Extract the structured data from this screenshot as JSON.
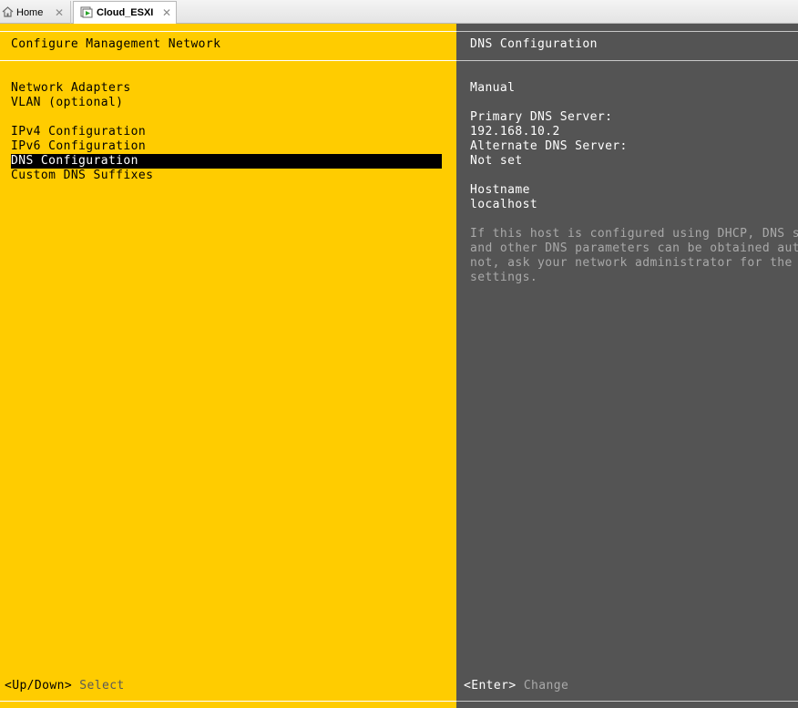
{
  "tabs": {
    "home": {
      "label": "Home",
      "icon": "home-icon"
    },
    "vm": {
      "label": "Cloud_ESXI",
      "icon": "vm-console-icon"
    },
    "close_glyph": "✕"
  },
  "left_panel": {
    "title": "Configure Management Network",
    "menu_items": [
      "Network Adapters",
      "VLAN (optional)",
      "IPv4 Configuration",
      "IPv6 Configuration",
      "DNS Configuration",
      "Custom DNS Suffixes"
    ],
    "selected_index": 4,
    "footer": {
      "key": "<Up/Down>",
      "action": "Select"
    }
  },
  "right_panel": {
    "title": "DNS Configuration",
    "mode": "Manual",
    "primary_dns_label": "Primary DNS Server:",
    "primary_dns_value": "192.168.10.2",
    "alternate_dns_label": "Alternate DNS Server:",
    "alternate_dns_value": "Not set",
    "hostname_label": "Hostname",
    "hostname_value": "localhost",
    "help_lines": [
      "If this host is configured using DHCP, DNS se",
      "and other DNS parameters can be obtained auto",
      "not, ask your network administrator for the a",
      "settings."
    ],
    "footer": {
      "key": "<Enter>",
      "action": "Change"
    }
  },
  "colors": {
    "left_background": "#ffcc00",
    "right_background": "#545454",
    "selection_background": "#000000"
  }
}
